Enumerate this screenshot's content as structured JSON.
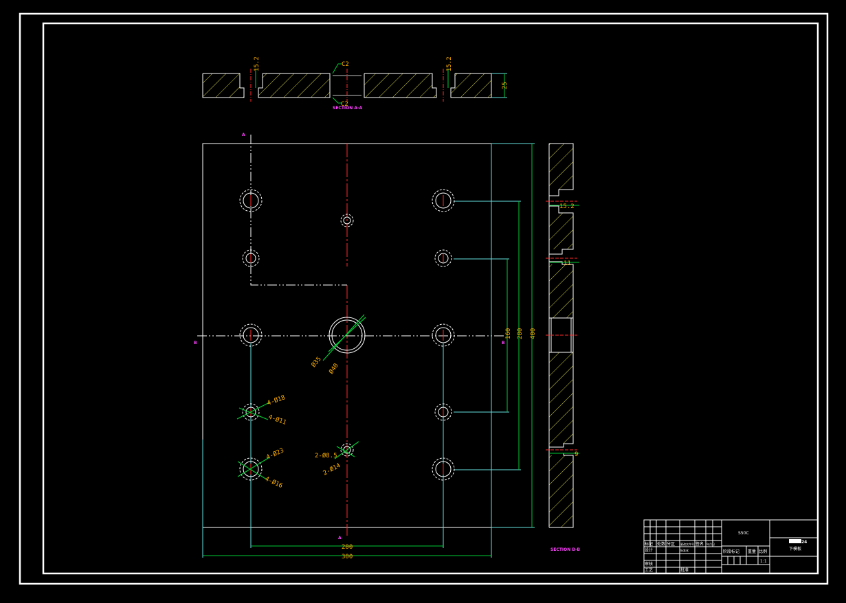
{
  "drawing": {
    "section_aa_label": "SECTION A-A",
    "section_bb_label": "SECTION B-B",
    "section_marks": [
      "B",
      "B",
      "A",
      "A"
    ]
  },
  "dimensions": {
    "top_depth_left": "15.2",
    "top_depth_right": "15.2",
    "top_thickness": "25",
    "chamfer_top": "C2",
    "chamfer_bottom": "C2",
    "height_160": "160",
    "height_280": "280",
    "height_400": "400",
    "width_200": "200",
    "width_300": "300",
    "center_d35": "Ø35",
    "center_d40": "Ø40",
    "hole_4x18": "4-Ø18",
    "hole_4x11": "4-Ø11",
    "hole_4x23": "4-Ø23",
    "hole_4x16": "4-Ø16",
    "hole_2x8_5": "2-Ø8.5",
    "hole_2x14": "2-Ø14",
    "side_15_2": "15.2",
    "side_11": "11",
    "side_9": "9"
  },
  "title_block": {
    "material": "S50C",
    "part_no": "24",
    "part_name": "下模板",
    "scale": "1:1",
    "labels_small": [
      "标记",
      "处数",
      "分区",
      "更改文件号",
      "签名",
      "年月日"
    ],
    "row_labels": [
      "设计",
      "标准化",
      "审核",
      "工艺",
      "批准"
    ],
    "stage_label": "阶段标记",
    "weight_label": "重量",
    "scale_label": "比例"
  },
  "colors": {
    "border": "#ffffff",
    "outline": "#ffffff",
    "hatch": "#d8d84a",
    "center": "#ff2a2a",
    "dim_line": "#00cc33",
    "ext_line": "#66e0e0",
    "dim_text": "#ffb000",
    "label": "#ff40ff"
  }
}
